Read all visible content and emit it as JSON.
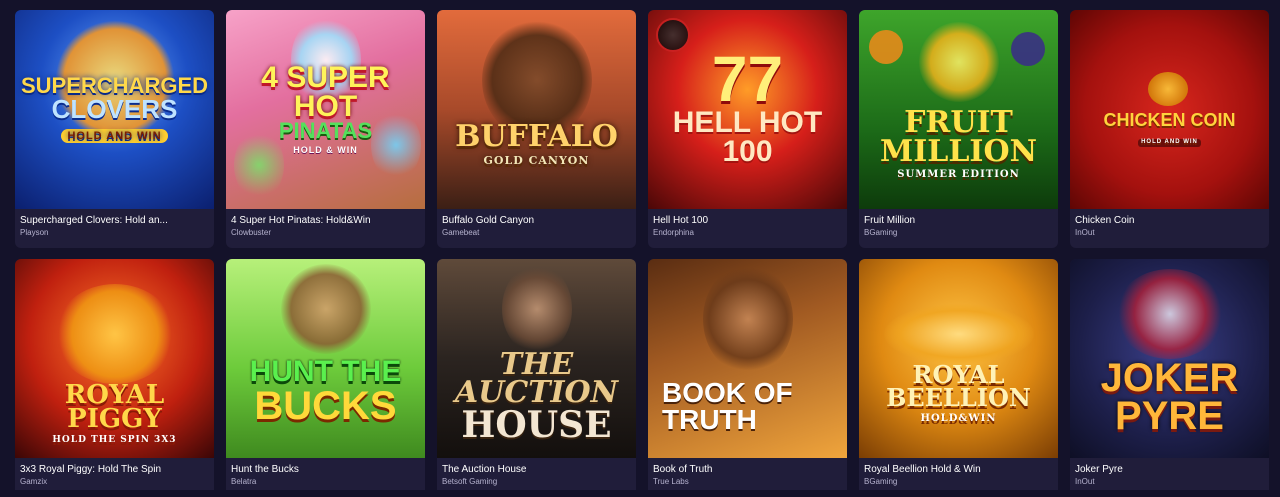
{
  "games": [
    {
      "title": "Supercharged Clovers: Hold an...",
      "provider": "Playson",
      "art": {
        "l1": "Supercharged",
        "l2": "Clovers",
        "l3": "Hold and Win"
      }
    },
    {
      "title": "4 Super Hot Pinatas: Hold&Win",
      "provider": "Clowbuster",
      "art": {
        "l1": "4 Super Hot",
        "l2": "Pinatas",
        "l3": "Hold & Win"
      }
    },
    {
      "title": "Buffalo Gold Canyon",
      "provider": "Gamebeat",
      "art": {
        "l1": "Buffalo",
        "l2": "",
        "l3": "Gold Canyon"
      }
    },
    {
      "title": "Hell Hot 100",
      "provider": "Endorphina",
      "art": {
        "l1": "77",
        "l2": "Hell Hot 100",
        "l3": ""
      }
    },
    {
      "title": "Fruit Million",
      "provider": "BGaming",
      "art": {
        "l1": "Fruit Million",
        "l2": "",
        "l3": "Summer Edition"
      }
    },
    {
      "title": "Chicken Coin",
      "provider": "InOut",
      "art": {
        "l1": "Chicken Coin",
        "l2": "",
        "l3": "Hold and Win"
      }
    },
    {
      "title": "3x3 Royal Piggy: Hold The Spin",
      "provider": "Gamzix",
      "art": {
        "l1": "Royal Piggy",
        "l2": "",
        "l3": "Hold The Spin 3x3"
      }
    },
    {
      "title": "Hunt the Bucks",
      "provider": "Belatra",
      "art": {
        "l1": "Hunt the",
        "l2": "Bucks",
        "l3": ""
      }
    },
    {
      "title": "The Auction House",
      "provider": "Betsoft Gaming",
      "art": {
        "l1": "The Auction",
        "l2": "House",
        "l3": ""
      }
    },
    {
      "title": "Book of Truth",
      "provider": "True Labs",
      "art": {
        "l1": "Book of Truth",
        "l2": "",
        "l3": ""
      }
    },
    {
      "title": "Royal Beellion Hold & Win",
      "provider": "BGaming",
      "art": {
        "l1": "Royal Beellion",
        "l2": "",
        "l3": "Hold&Win"
      }
    },
    {
      "title": "Joker Pyre",
      "provider": "InOut",
      "art": {
        "l1": "Joker Pyre",
        "l2": "",
        "l3": ""
      }
    }
  ]
}
